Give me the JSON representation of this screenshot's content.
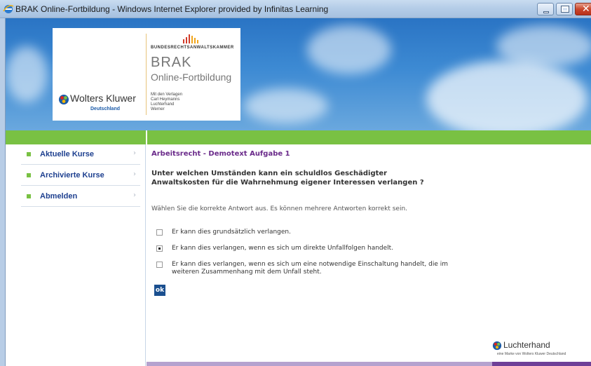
{
  "window": {
    "title": "BRAK Online-Fortbildung - Windows Internet Explorer provided by Infinitas Learning",
    "minimize_icon": "minimize-icon",
    "maximize_icon": "maximize-icon",
    "close_icon": "close-icon",
    "close_glyph": "✕"
  },
  "header": {
    "wk_name": "Wolters Kluwer",
    "wk_sub": "Deutschland",
    "chamber": "BUNDESRECHTSANWALTSKAMMER",
    "brak_title": "BRAK",
    "brak_subtitle": "Online-Fortbildung",
    "publishers": [
      "Mit den Verlagen",
      "Carl Heymanns",
      "Luchterhand",
      "Werner"
    ],
    "colors": {
      "sky": "#2a74c4",
      "green": "#79c143",
      "brak_bar": "#d23b2a"
    }
  },
  "sidebar": {
    "items": [
      {
        "label": "Aktuelle Kurse",
        "arrow": "›"
      },
      {
        "label": "Archivierte Kurse",
        "arrow": "›"
      },
      {
        "label": "Abmelden",
        "arrow": "›"
      }
    ]
  },
  "main": {
    "course_title": "Arbeitsrecht - Demotext Aufgabe 1",
    "question": "Unter welchen Umständen kann ein schuldlos Geschädigter Anwaltskosten für die Wahrnehmung eigener Interessen verlangen ?",
    "instruction": "Wählen Sie die korrekte Antwort aus. Es können mehrere Antworten korrekt sein.",
    "answers": [
      {
        "text": "Er kann dies grundsätzlich verlangen.",
        "checked": false
      },
      {
        "text": "Er kann dies verlangen, wenn es sich um direkte Unfallfolgen handelt.",
        "checked": true
      },
      {
        "text": "Er kann dies verlangen, wenn es sich um eine notwendige Einschaltung handelt, die im weiteren Zusammenhang mit dem Unfall steht.",
        "checked": false
      }
    ],
    "ok_label": "ok"
  },
  "footer": {
    "brand": "Luchterhand",
    "tagline": "eine Marke von Wolters Kluwer Deutschland"
  }
}
